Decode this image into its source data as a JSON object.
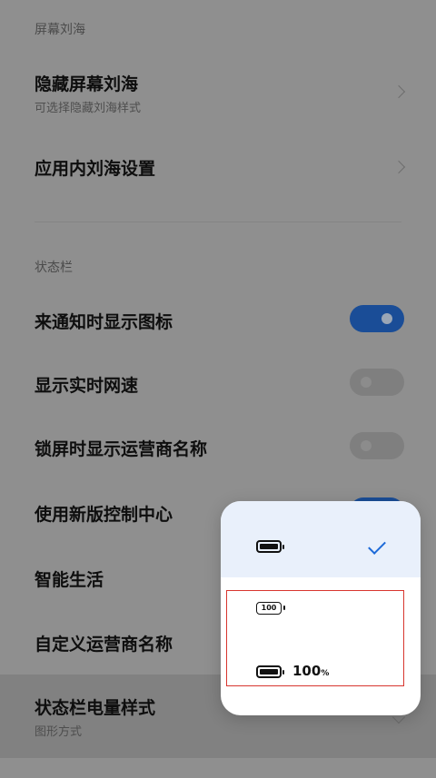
{
  "sections": {
    "notch_title": "屏幕刘海",
    "statusbar_title": "状态栏"
  },
  "rows": {
    "hide_notch": {
      "title": "隐藏屏幕刘海",
      "subtitle": "可选择隐藏刘海样式"
    },
    "app_notch": {
      "title": "应用内刘海设置"
    },
    "notif_icons": {
      "title": "来通知时显示图标",
      "toggle": true
    },
    "net_speed": {
      "title": "显示实时网速",
      "toggle": false
    },
    "carrier_lock": {
      "title": "锁屏时显示运营商名称",
      "toggle": false
    },
    "new_control": {
      "title": "使用新版控制中心",
      "toggle": true
    },
    "smart_life": {
      "title": "智能生活"
    },
    "custom_carrier": {
      "title": "自定义运营商名称"
    },
    "battery_style": {
      "title": "状态栏电量样式",
      "subtitle": "图形方式"
    }
  },
  "popup": {
    "options": [
      {
        "icon": "battery-graphic-icon",
        "selected": true
      },
      {
        "icon": "battery-number-icon",
        "battery_label": "100",
        "selected": false
      },
      {
        "icon": "battery-graphic-icon",
        "value_text": "100",
        "unit_text": "%",
        "selected": false
      }
    ]
  },
  "colors": {
    "accent": "#1d6ad8",
    "toggle_on": "#1a4d97",
    "highlight_box": "#d8362f"
  }
}
